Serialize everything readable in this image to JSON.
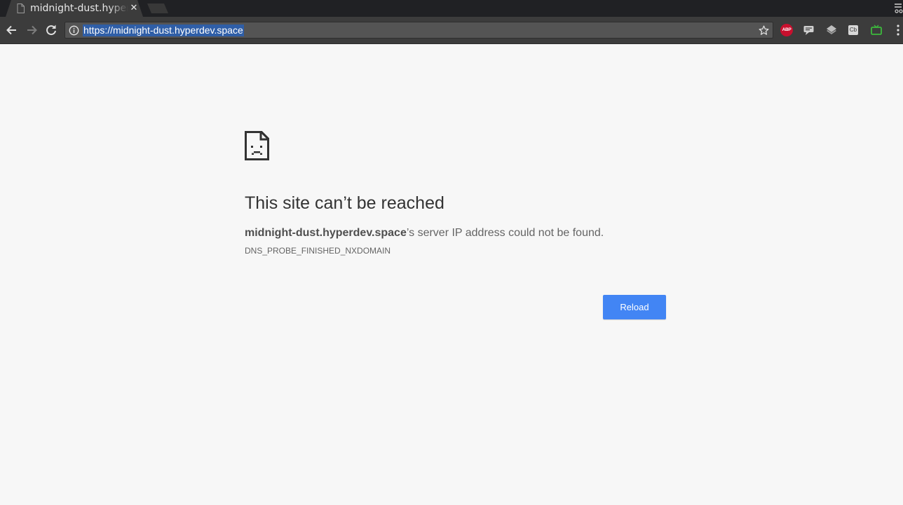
{
  "browser": {
    "tab": {
      "title": "midnight-dust.hyperdev.space",
      "favicon": "page-icon",
      "close_icon": "close-icon",
      "close_glyph": "✕"
    },
    "toolbar": {
      "back_icon": "arrow-back-icon",
      "forward_icon": "arrow-forward-icon",
      "reload_icon": "reload-icon",
      "url": "https://midnight-dust.hyperdev.space",
      "site_info_icon": "info-icon",
      "bookmark_icon": "star-icon",
      "extensions": [
        {
          "name": "adblock-plus-icon",
          "label": "ABP"
        },
        {
          "name": "chat-icon"
        },
        {
          "name": "layers-icon"
        },
        {
          "name": "cb-extension-icon",
          "label": "Cb"
        },
        {
          "name": "tv-icon"
        }
      ],
      "menu_icon": "kebab-menu-icon"
    }
  },
  "error_page": {
    "icon": "sad-page-icon",
    "heading": "This site can’t be reached",
    "summary_host": "midnight-dust.hyperdev.space",
    "summary_rest": "’s server IP address could not be found.",
    "error_code": "DNS_PROBE_FINISHED_NXDOMAIN",
    "reload_label": "Reload"
  },
  "colors": {
    "page_background": "#f7f7f7",
    "chrome_dark": "#3c3c3c",
    "url_selection": "#2f5ea7",
    "reload_button": "#4285f4",
    "abp_red": "#c8102e",
    "tv_green": "#3cba3c"
  }
}
